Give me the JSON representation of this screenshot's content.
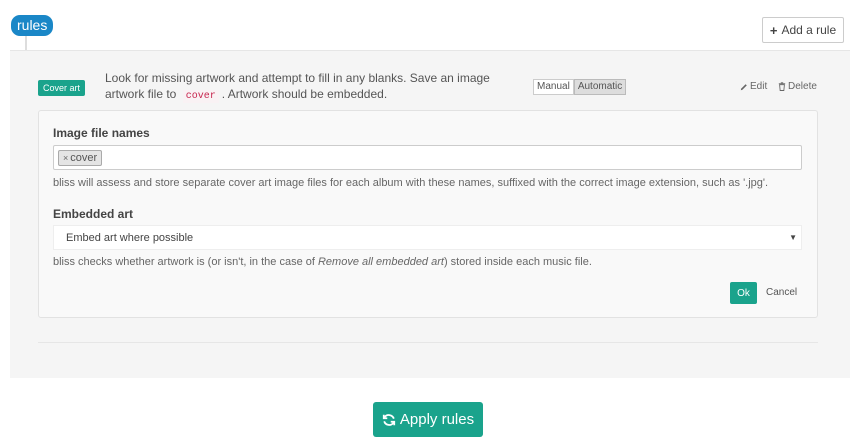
{
  "header": {
    "title": "rules",
    "add_rule_label": "Add a rule",
    "add_icon": "plus-icon"
  },
  "rule": {
    "tag": "Cover art",
    "description_part1": "Look for missing artwork and attempt to fill in any blanks. Save an image artwork file to",
    "description_code": "cover",
    "description_part2": ". Artwork should be embedded.",
    "mode_manual": "Manual",
    "mode_automatic": "Automatic",
    "mode_selected": "Automatic",
    "edit_label": "Edit",
    "delete_label": "Delete",
    "edit_icon": "pencil-icon",
    "delete_icon": "trash-icon"
  },
  "form": {
    "image_names_label": "Image file names",
    "image_names_tags": [
      "cover"
    ],
    "image_names_help": "bliss will assess and store separate cover art image files for each album with these names, suffixed with the correct image extension, such as '.jpg'.",
    "embedded_label": "Embedded art",
    "embedded_value": "Embed art where possible",
    "embedded_help_part1": "bliss checks whether artwork is (or isn't, in the case of ",
    "embedded_help_em": "Remove all embedded art",
    "embedded_help_part2": ") stored inside each music file.",
    "ok_label": "Ok",
    "cancel_label": "Cancel"
  },
  "footer": {
    "apply_label": "Apply rules",
    "apply_icon": "refresh-icon"
  },
  "colors": {
    "accent_teal": "#1aa38c",
    "badge_blue": "#1a87c7"
  }
}
